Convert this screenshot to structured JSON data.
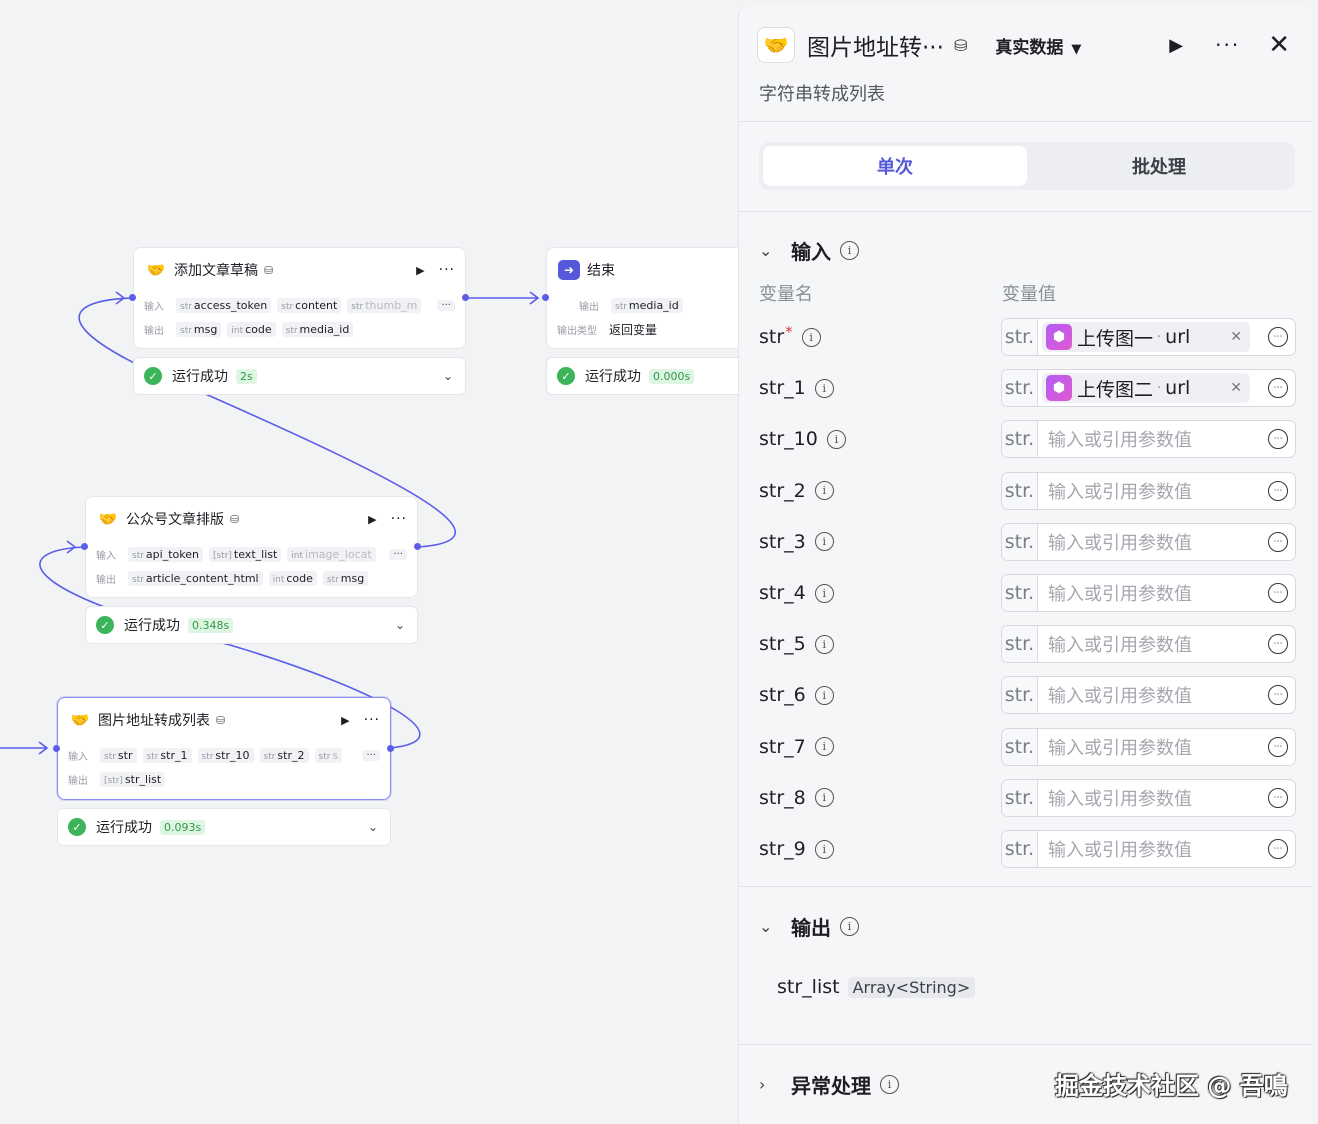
{
  "canvas": {
    "nodes": [
      {
        "title": "添加文章草稿",
        "tag_icon": "database-icon",
        "inputs_label": "输入",
        "outputs_label": "输出",
        "inputs": [
          {
            "type": "str",
            "name": "access_token"
          },
          {
            "type": "str",
            "name": "content"
          },
          {
            "type": "str",
            "name": "thumb_m"
          }
        ],
        "outputs": [
          {
            "type": "str",
            "name": "msg"
          },
          {
            "type": "int",
            "name": "code"
          },
          {
            "type": "str",
            "name": "media_id"
          }
        ],
        "status": "运行成功",
        "time": "2s"
      },
      {
        "title": "结束",
        "outputs_label": "输出",
        "outputs": [
          {
            "type": "str",
            "name": "media_id"
          }
        ],
        "output_type_label": "输出类型",
        "output_type_value": "返回变量",
        "status": "运行成功",
        "time": "0.000s"
      },
      {
        "title": "公众号文章排版",
        "inputs_label": "输入",
        "outputs_label": "输出",
        "inputs": [
          {
            "type": "str",
            "name": "api_token"
          },
          {
            "type": "[str]",
            "name": "text_list"
          },
          {
            "type": "int",
            "name": "image_locat"
          }
        ],
        "outputs": [
          {
            "type": "str",
            "name": "article_content_html"
          },
          {
            "type": "int",
            "name": "code"
          },
          {
            "type": "str",
            "name": "msg"
          }
        ],
        "status": "运行成功",
        "time": "0.348s"
      },
      {
        "title": "图片地址转成列表",
        "inputs_label": "输入",
        "outputs_label": "输出",
        "inputs": [
          {
            "type": "str",
            "name": "str"
          },
          {
            "type": "str",
            "name": "str_1"
          },
          {
            "type": "str",
            "name": "str_10"
          },
          {
            "type": "str",
            "name": "str_2"
          },
          {
            "type": "str",
            "name": "s"
          }
        ],
        "outputs": [
          {
            "type": "[str]",
            "name": "str_list"
          }
        ],
        "status": "运行成功",
        "time": "0.093s"
      }
    ],
    "more_chip": "···"
  },
  "panel": {
    "title": "图片地址转···",
    "mode": "真实数据",
    "description": "字符串转成列表",
    "tabs": [
      {
        "label": "单次",
        "active": true
      },
      {
        "label": "批处理",
        "active": false
      }
    ],
    "input_section": "输入",
    "col_name": "变量名",
    "col_value": "变量值",
    "type_prefix": "str.",
    "placeholder": "输入或引用参数值",
    "variables": [
      {
        "name": "str",
        "required": true,
        "ref": {
          "node": "上传图一",
          "field": "url"
        }
      },
      {
        "name": "str_1",
        "required": false,
        "ref": {
          "node": "上传图二",
          "field": "url"
        }
      },
      {
        "name": "str_10",
        "required": false,
        "ref": null
      },
      {
        "name": "str_2",
        "required": false,
        "ref": null
      },
      {
        "name": "str_3",
        "required": false,
        "ref": null
      },
      {
        "name": "str_4",
        "required": false,
        "ref": null
      },
      {
        "name": "str_5",
        "required": false,
        "ref": null
      },
      {
        "name": "str_6",
        "required": false,
        "ref": null
      },
      {
        "name": "str_7",
        "required": false,
        "ref": null
      },
      {
        "name": "str_8",
        "required": false,
        "ref": null
      },
      {
        "name": "str_9",
        "required": false,
        "ref": null
      }
    ],
    "output_section": "输出",
    "output": {
      "name": "str_list",
      "type": "Array<String>"
    },
    "error_section": "异常处理",
    "watermark": "掘金技术社区 @ 吾鳴"
  },
  "colors": {
    "accent": "#5558d8",
    "wire": "#5a5ee8",
    "success": "#3cb55a",
    "success_bg": "#dff5e4",
    "required": "#d93a3a"
  }
}
